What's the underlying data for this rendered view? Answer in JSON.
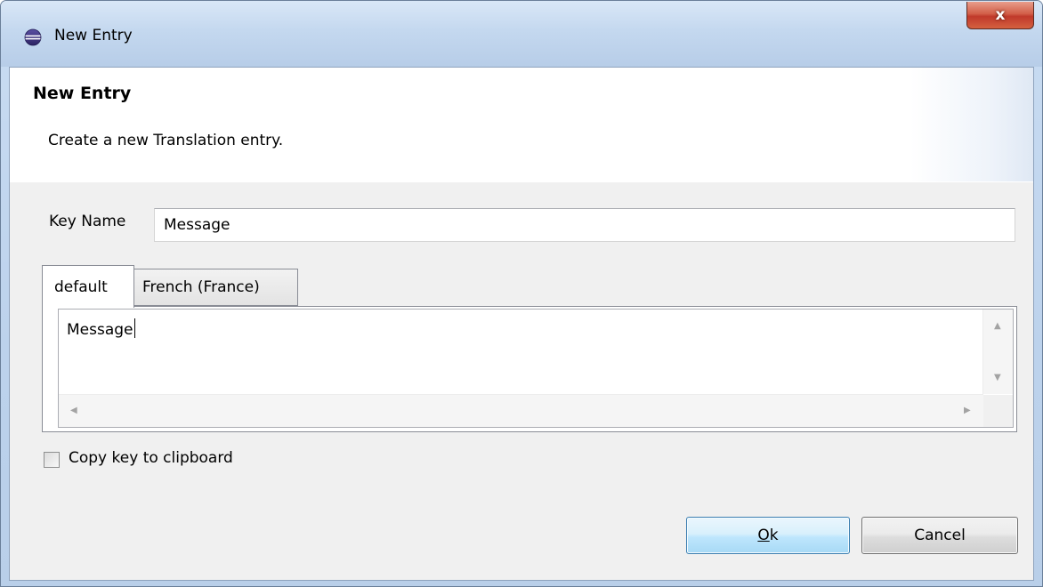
{
  "window": {
    "title": "New Entry",
    "close_label": "x"
  },
  "banner": {
    "title": "New Entry",
    "description": "Create a new Translation entry."
  },
  "form": {
    "key_label": "Key Name",
    "key_value": "Message"
  },
  "tabs": [
    {
      "label": "default",
      "selected": true
    },
    {
      "label": "French (France)",
      "selected": false
    }
  ],
  "editor": {
    "text": "Message"
  },
  "clipboard": {
    "label": "Copy key to clipboard",
    "checked": false
  },
  "buttons": {
    "ok_mnemonic": "O",
    "ok_rest": "k",
    "cancel": "Cancel"
  },
  "icons": {
    "app": "eclipse-icon",
    "close": "close-icon"
  }
}
